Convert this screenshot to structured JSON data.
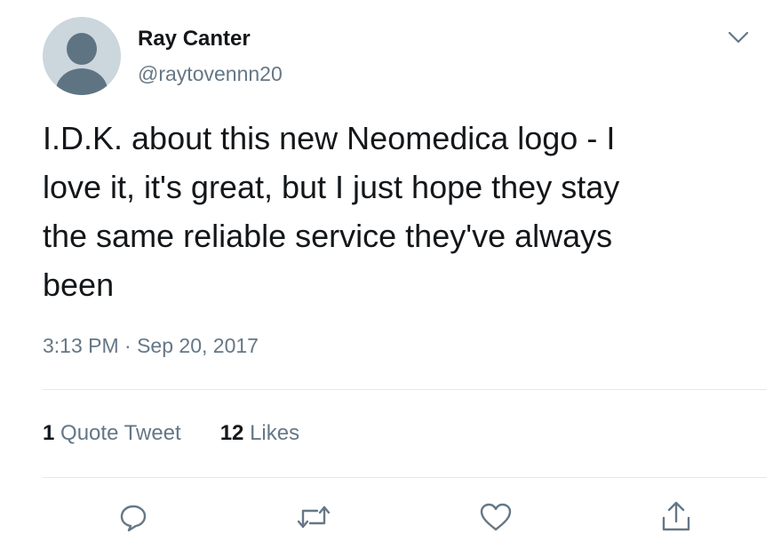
{
  "author": {
    "display_name": "Ray Canter",
    "handle": "@raytovennn20",
    "avatar_icon": "default-avatar-icon"
  },
  "tweet": {
    "text": "I.D.K. about this new Neomedica logo - I\nlove it, it's great, but I just hope they stay\nthe same reliable service they've always\nbeen",
    "timestamp": "3:13 PM · Sep 20, 2017"
  },
  "stats": {
    "quote_tweets_count": "1",
    "quote_tweets_label": "Quote Tweet",
    "likes_count": "12",
    "likes_label": "Likes"
  },
  "actions": [
    {
      "icon": "reply-icon"
    },
    {
      "icon": "retweet-icon"
    },
    {
      "icon": "like-icon"
    },
    {
      "icon": "share-icon"
    }
  ],
  "colors": {
    "text_primary": "#14171a",
    "text_secondary": "#657786",
    "divider": "#e1e8ed",
    "avatar_bg": "#ccd6dd",
    "avatar_fg": "#5f7483"
  }
}
